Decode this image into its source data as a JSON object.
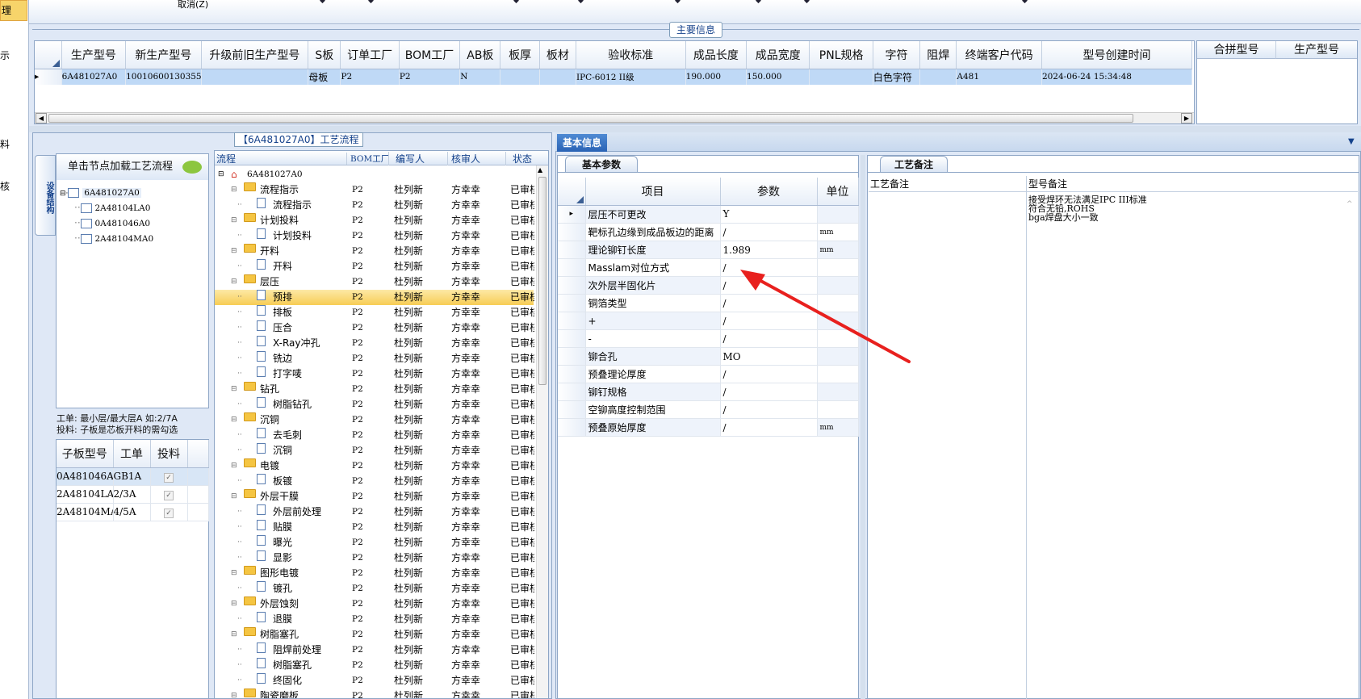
{
  "left_strip": {
    "item1": "理",
    "item2": "示",
    "item3": "料",
    "item4": "核"
  },
  "top": {
    "cancel": "取消(Z)"
  },
  "main_group": {
    "title": "主要信息"
  },
  "main_grid": {
    "headers": [
      "生产型号",
      "新生产型号",
      "升级前旧生产型号",
      "S板",
      "订单工厂",
      "BOM工厂",
      "AB板",
      "板厚",
      "板材",
      "验收标准",
      "成品长度",
      "成品宽度",
      "PNL规格",
      "字符",
      "阻焊",
      "终端客户代码",
      "型号创建时间"
    ],
    "row": [
      "6A481027A0",
      "10010600130355",
      "",
      "母板",
      "P2",
      "P2",
      "N",
      "",
      "",
      "IPC-6012 II级",
      "190.000",
      "150.000",
      "",
      "白色字符",
      "",
      "A481",
      "2024-06-24 15:34:48"
    ]
  },
  "merge_grid": {
    "headers": [
      "合拼型号",
      "生产型号"
    ]
  },
  "flow_panel": {
    "title": "【6A481027A0】工艺流程",
    "vtab": "设备结构",
    "load_hint": "单击节点加载工艺流程",
    "tree": [
      "6A481027A0",
      "2A48104LA0",
      "0A481046A0",
      "2A48104MA0"
    ],
    "note": "工单: 最小层/最大层A 如:2/7A\n投料: 子板是芯板开料的需勾选",
    "sub_headers": [
      "子板型号",
      "工单",
      "投料"
    ],
    "sub_rows": [
      [
        "0A481046A0",
        "GB1A"
      ],
      [
        "2A48104LA0",
        "2/3A"
      ],
      [
        "2A48104MA0",
        "4/5A"
      ]
    ]
  },
  "flow_grid": {
    "headers": [
      "流程",
      "BOM工厂",
      "编写人",
      "核审人",
      "状态"
    ],
    "root": "6A481027A0",
    "rows": [
      {
        "n": "流程指示",
        "t": "f"
      },
      {
        "n": "流程指示",
        "t": "d"
      },
      {
        "n": "计划投料",
        "t": "f"
      },
      {
        "n": "计划投料",
        "t": "d"
      },
      {
        "n": "开料",
        "t": "f"
      },
      {
        "n": "开料",
        "t": "d"
      },
      {
        "n": "层压",
        "t": "f"
      },
      {
        "n": "预排",
        "t": "d",
        "sel": true
      },
      {
        "n": "排板",
        "t": "d"
      },
      {
        "n": "压合",
        "t": "d"
      },
      {
        "n": "X-Ray冲孔",
        "t": "d"
      },
      {
        "n": "铣边",
        "t": "d"
      },
      {
        "n": "打字唛",
        "t": "d"
      },
      {
        "n": "钻孔",
        "t": "f"
      },
      {
        "n": "树脂钻孔",
        "t": "d"
      },
      {
        "n": "沉铜",
        "t": "f"
      },
      {
        "n": "去毛刺",
        "t": "d"
      },
      {
        "n": "沉铜",
        "t": "d"
      },
      {
        "n": "电镀",
        "t": "f"
      },
      {
        "n": "板镀",
        "t": "d"
      },
      {
        "n": "外层干膜",
        "t": "f"
      },
      {
        "n": "外层前处理",
        "t": "d"
      },
      {
        "n": "贴膜",
        "t": "d"
      },
      {
        "n": "曝光",
        "t": "d"
      },
      {
        "n": "显影",
        "t": "d"
      },
      {
        "n": "图形电镀",
        "t": "f"
      },
      {
        "n": "镀孔",
        "t": "d"
      },
      {
        "n": "外层蚀刻",
        "t": "f"
      },
      {
        "n": "退膜",
        "t": "d"
      },
      {
        "n": "树脂塞孔",
        "t": "f"
      },
      {
        "n": "阻焊前处理",
        "t": "d"
      },
      {
        "n": "树脂塞孔",
        "t": "d"
      },
      {
        "n": "终固化",
        "t": "d"
      },
      {
        "n": "陶瓷磨板",
        "t": "f"
      }
    ],
    "bom": "P2",
    "writer": "杜列新",
    "reviewer": "方幸幸",
    "status": "已审核"
  },
  "basic_info": {
    "tab": "基本信息",
    "params_tab": "基本参数",
    "headers": [
      "项目",
      "参数",
      "单位"
    ],
    "rows": [
      [
        "层压不可更改",
        "Y",
        ""
      ],
      [
        "靶标孔边缘到成品板边的距离",
        "/",
        "mm"
      ],
      [
        "理论铆钉长度",
        "1.989",
        "mm"
      ],
      [
        "Masslam对位方式",
        "/",
        ""
      ],
      [
        "次外层半固化片",
        "/",
        ""
      ],
      [
        "铜箔类型",
        "/",
        ""
      ],
      [
        "+",
        "/",
        ""
      ],
      [
        "-",
        "/",
        ""
      ],
      [
        "铆合孔",
        "MO",
        ""
      ],
      [
        "预叠理论厚度",
        "/",
        ""
      ],
      [
        "铆钉规格",
        "/",
        ""
      ],
      [
        "空铆高度控制范围",
        "/",
        ""
      ],
      [
        "预叠原始厚度",
        "/",
        "mm"
      ]
    ]
  },
  "remarks": {
    "tab": "工艺备注",
    "col1": "工艺备注",
    "col2": "型号备注",
    "text": "接受焊环无法满足IPC III标准\n符合无铅,ROHS\nbga焊盘大小一致"
  },
  "colors": {
    "accent": "#15428b",
    "selection": "#bfd9f6",
    "highlight": "#f7d46a",
    "arrow": "#e8201e"
  }
}
